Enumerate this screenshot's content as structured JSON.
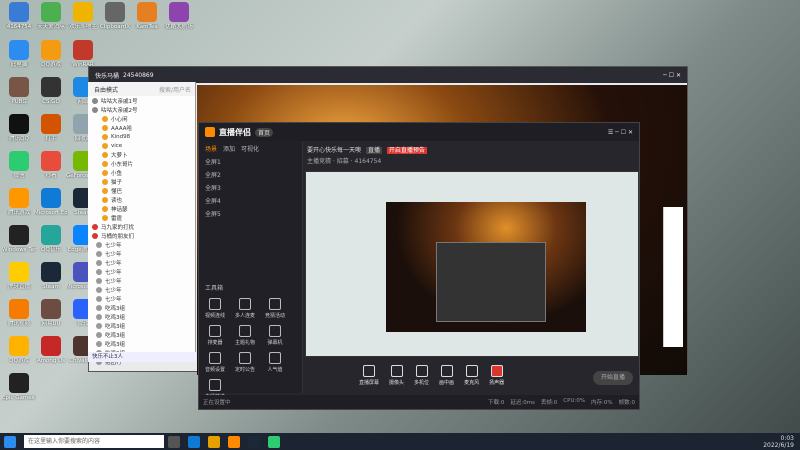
{
  "desktop": {
    "icons": [
      {
        "label": "4164754",
        "color": "#3a7bd5"
      },
      {
        "label": "天天爱消除",
        "color": "#4caf50"
      },
      {
        "label": "欢乐斗地主",
        "color": "#f0b400"
      },
      {
        "label": "ClipboardX",
        "color": "#666666"
      },
      {
        "label": "KamTea",
        "color": "#e67e22"
      },
      {
        "label": "优酷大剧场",
        "color": "#8e44ad"
      },
      {
        "label": "此电脑",
        "color": "#2d8cf0"
      },
      {
        "label": "QQ游戏",
        "color": "#f39c12"
      },
      {
        "label": "WinRAR",
        "color": "#c0392b"
      },
      {
        "label": "PUBG",
        "color": "#795548"
      },
      {
        "label": "CS:GO",
        "color": "#333333"
      },
      {
        "label": "网络",
        "color": "#1e88e5"
      },
      {
        "label": "腾讯QQ",
        "color": "#111111"
      },
      {
        "label": "打手",
        "color": "#d35400"
      },
      {
        "label": "回收站",
        "color": "#90a4ae"
      },
      {
        "label": "微信",
        "color": "#2ecc71"
      },
      {
        "label": "秒看",
        "color": "#e74c3c"
      },
      {
        "label": "GeForce Experience",
        "color": "#76b900"
      },
      {
        "label": "腾讯游戏",
        "color": "#ff9800"
      },
      {
        "label": "Microsoft Edge",
        "color": "#0f7bd6"
      },
      {
        "label": "Steam",
        "color": "#1b2838"
      },
      {
        "label": "Windows Terminal",
        "color": "#222222"
      },
      {
        "label": "QQ音乐",
        "color": "#26a69a"
      },
      {
        "label": "Edge浏览器",
        "color": "#0a84ff"
      },
      {
        "label": "虎牙直播",
        "color": "#ffcc00"
      },
      {
        "label": "Steam",
        "color": "#1b2838"
      },
      {
        "label": "Microsoft Teams",
        "color": "#4b53bc"
      },
      {
        "label": "腾讯视频",
        "color": "#f57c00"
      },
      {
        "label": "网易UU",
        "color": "#6d4c41"
      },
      {
        "label": "微软",
        "color": "#2962ff"
      },
      {
        "label": "QQ游戏",
        "color": "#ffb300"
      },
      {
        "label": "Among Us",
        "color": "#c62828"
      },
      {
        "label": "Chivalry 2",
        "color": "#4e342e"
      },
      {
        "label": "Epic Games Launcher",
        "color": "#222222"
      }
    ]
  },
  "qq_window": {
    "title": "快乐马桶",
    "id": "24540869",
    "count": "20",
    "status": "自由模式",
    "search_placeholder": "搜索/用户名",
    "groups": [
      "咕咕大亲戚1号",
      "咕咕大亲戚2号"
    ],
    "contacts": [
      "小心闲",
      "AAAA哈",
      "Kind98",
      "vice",
      "大萝卜",
      "小东哥片",
      "小鱼",
      "猫子",
      "懂巴",
      "读也",
      "神话瑟",
      "雷霆"
    ],
    "sections": [
      "马九家的打扰",
      "马桶的朋友们"
    ],
    "others": [
      "七少年",
      "七少年",
      "七少年",
      "七少年",
      "七少年",
      "七少年",
      "七少年",
      "吃鸡3组",
      "吃鸡3组",
      "吃鸡3组",
      "吃鸡3组",
      "吃鸡3组",
      "吃鸡3组",
      "抱团行"
    ],
    "footer": "快乐不止3人"
  },
  "stream_window": {
    "title": "直播伴侣",
    "tab_main": "快乐咪",
    "status_badge": "首页",
    "title_text": "要开心快乐每一天噢",
    "tag": "直播",
    "tag2": "开启直播预告",
    "sub1": "主播竞猜",
    "sub2": "招募",
    "sub3": "4164754",
    "scene_tabs": [
      "场景",
      "添加",
      "可视化"
    ],
    "scenes": [
      "全屏1",
      "全屏2",
      "全屏3",
      "全屏4",
      "全屏5"
    ],
    "toolbox_label": "工具箱",
    "tools": [
      "视频连线",
      "多人连麦",
      "竞猜活动",
      "排麦器",
      "主题礼物",
      "弹幕机",
      "音频设置",
      "定时公告",
      "人气值",
      "主播精选"
    ],
    "bottom_tools": [
      "直播屏幕",
      "摄像头",
      "多机位",
      "画中画",
      "麦克风",
      "扬声器"
    ],
    "start_button": "开始直播",
    "status_bar": "正在设置中",
    "stats": [
      "下载:0",
      "延迟:0ms",
      "丢帧:0",
      "CPU:0%",
      "内存:0%",
      "帧数:0"
    ]
  },
  "taskbar": {
    "search_placeholder": "在这里输入你要搜索的内容",
    "time": "0:03",
    "date": "2022/6/19",
    "lang": "中"
  },
  "colors": {
    "accent": "#ff8a00",
    "window_bg": "#2a2b33",
    "taskbar": "#1c2432"
  }
}
